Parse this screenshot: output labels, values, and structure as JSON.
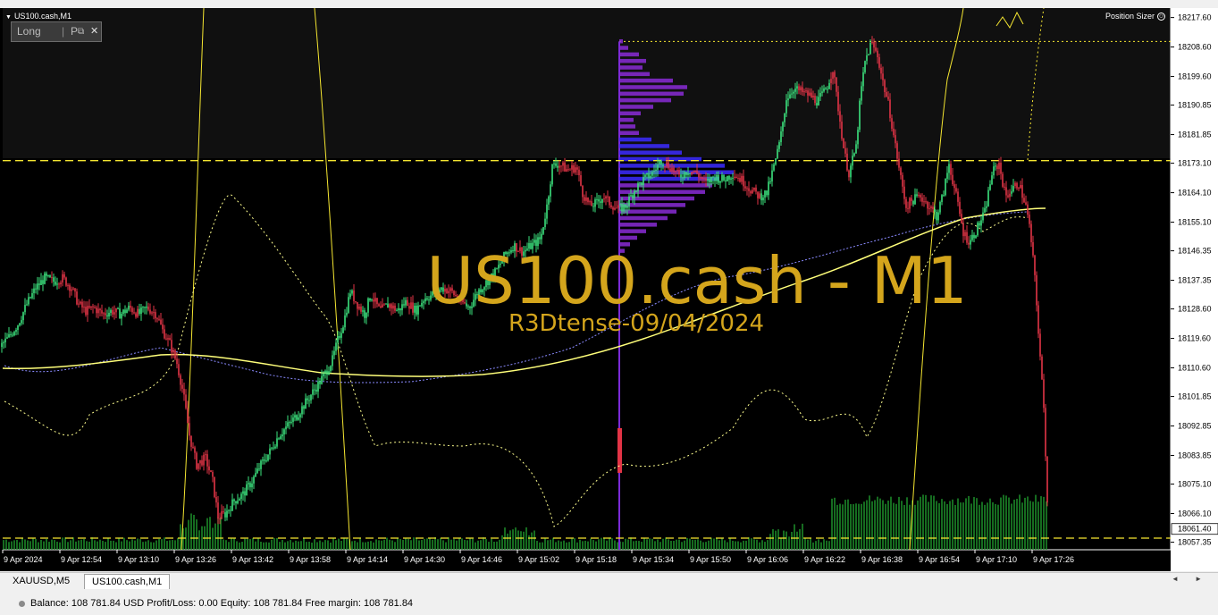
{
  "window": {
    "title": "US100.cash,M1",
    "panel_direction": "Long",
    "panel_tab": "P",
    "panel_restore_icon": "restore-window-icon",
    "panel_close": "✕",
    "position_sizer": "Position Sizer",
    "position_sizer_icon": "smiley-icon"
  },
  "watermark": {
    "title": "US100.cash - M1",
    "subtitle": "R3Dtense-09/04/2024",
    "color": "#d4a51c"
  },
  "chart_data": {
    "type": "candlestick",
    "symbol": "US100.cash",
    "timeframe": "M1",
    "ylim": [
      18054.5,
      18220.5
    ],
    "y_ticks": [
      "18217.60",
      "18208.60",
      "18199.60",
      "18190.85",
      "18181.85",
      "18173.10",
      "18164.10",
      "18155.10",
      "18146.35",
      "18137.35",
      "18128.60",
      "18119.60",
      "18110.60",
      "18101.85",
      "18092.85",
      "18083.85",
      "18075.10",
      "18066.10",
      "18057.35"
    ],
    "current_price": "18061.40",
    "x_ticks": [
      "9 Apr 2024",
      "9 Apr 12:54",
      "9 Apr 13:10",
      "9 Apr 13:26",
      "9 Apr 13:42",
      "9 Apr 13:58",
      "9 Apr 14:14",
      "9 Apr 14:30",
      "9 Apr 14:46",
      "9 Apr 15:02",
      "9 Apr 15:18",
      "9 Apr 15:34",
      "9 Apr 15:50",
      "9 Apr 16:06",
      "9 Apr 16:22",
      "9 Apr 16:38",
      "9 Apr 16:54",
      "9 Apr 17:10",
      "9 Apr 17:26"
    ],
    "series": [
      {
        "name": "price",
        "points": [
          [
            0,
            18117
          ],
          [
            10,
            18120
          ],
          [
            20,
            18124
          ],
          [
            30,
            18130
          ],
          [
            40,
            18135
          ],
          [
            50,
            18138
          ],
          [
            60,
            18137
          ],
          [
            70,
            18138
          ],
          [
            80,
            18135
          ],
          [
            88,
            18130
          ],
          [
            96,
            18128
          ],
          [
            105,
            18129
          ],
          [
            115,
            18127
          ],
          [
            125,
            18128
          ],
          [
            135,
            18127
          ],
          [
            145,
            18129
          ],
          [
            155,
            18127
          ],
          [
            165,
            18129
          ],
          [
            175,
            18127
          ],
          [
            182,
            18122
          ],
          [
            190,
            18118
          ],
          [
            198,
            18112
          ],
          [
            205,
            18103
          ],
          [
            212,
            18090
          ],
          [
            220,
            18081
          ],
          [
            230,
            18083
          ],
          [
            238,
            18076
          ],
          [
            244,
            18065
          ],
          [
            252,
            18066
          ],
          [
            262,
            18070
          ],
          [
            272,
            18072
          ],
          [
            282,
            18076
          ],
          [
            292,
            18081
          ],
          [
            302,
            18085
          ],
          [
            312,
            18090
          ],
          [
            322,
            18093
          ],
          [
            332,
            18096
          ],
          [
            342,
            18100
          ],
          [
            352,
            18104
          ],
          [
            362,
            18108
          ],
          [
            372,
            18113
          ],
          [
            378,
            18119
          ],
          [
            385,
            18125
          ],
          [
            392,
            18134
          ],
          [
            400,
            18130
          ],
          [
            408,
            18127
          ],
          [
            415,
            18133
          ],
          [
            425,
            18128
          ],
          [
            435,
            18130
          ],
          [
            445,
            18128
          ],
          [
            455,
            18131
          ],
          [
            465,
            18128
          ],
          [
            475,
            18132
          ],
          [
            485,
            18133
          ],
          [
            495,
            18135
          ],
          [
            505,
            18134
          ],
          [
            515,
            18131
          ],
          [
            525,
            18129
          ],
          [
            535,
            18134
          ],
          [
            545,
            18137
          ],
          [
            555,
            18140
          ],
          [
            565,
            18145
          ],
          [
            575,
            18148
          ],
          [
            585,
            18146
          ],
          [
            595,
            18148
          ],
          [
            605,
            18150
          ],
          [
            612,
            18160
          ],
          [
            618,
            18172
          ],
          [
            625,
            18173
          ],
          [
            635,
            18171
          ],
          [
            645,
            18172
          ],
          [
            652,
            18164
          ],
          [
            660,
            18160
          ],
          [
            668,
            18161
          ],
          [
            675,
            18163
          ],
          [
            682,
            18161
          ],
          [
            692,
            18159
          ],
          [
            700,
            18160
          ],
          [
            710,
            18165
          ],
          [
            720,
            18168
          ],
          [
            730,
            18170
          ],
          [
            740,
            18174
          ],
          [
            750,
            18172
          ],
          [
            760,
            18169
          ],
          [
            770,
            18171
          ],
          [
            780,
            18170
          ],
          [
            790,
            18167
          ],
          [
            800,
            18169
          ],
          [
            810,
            18168
          ],
          [
            820,
            18170
          ],
          [
            830,
            18168
          ],
          [
            840,
            18165
          ],
          [
            850,
            18163
          ],
          [
            858,
            18164
          ],
          [
            866,
            18172
          ],
          [
            873,
            18180
          ],
          [
            880,
            18193
          ],
          [
            888,
            18196
          ],
          [
            896,
            18195
          ],
          [
            905,
            18194
          ],
          [
            915,
            18192
          ],
          [
            925,
            18196
          ],
          [
            932,
            18202
          ],
          [
            938,
            18190
          ],
          [
            945,
            18176
          ],
          [
            950,
            18170
          ],
          [
            958,
            18178
          ],
          [
            963,
            18194
          ],
          [
            968,
            18204
          ],
          [
            975,
            18210
          ],
          [
            982,
            18206
          ],
          [
            988,
            18198
          ],
          [
            995,
            18190
          ],
          [
            1001,
            18180
          ],
          [
            1007,
            18170
          ],
          [
            1014,
            18160
          ],
          [
            1022,
            18162
          ],
          [
            1030,
            18163
          ],
          [
            1040,
            18160
          ],
          [
            1048,
            18157
          ],
          [
            1055,
            18163
          ],
          [
            1062,
            18173
          ],
          [
            1070,
            18163
          ],
          [
            1078,
            18152
          ],
          [
            1085,
            18149
          ],
          [
            1093,
            18153
          ],
          [
            1102,
            18158
          ],
          [
            1110,
            18170
          ],
          [
            1118,
            18173
          ],
          [
            1125,
            18163
          ],
          [
            1132,
            18165
          ],
          [
            1140,
            18167
          ],
          [
            1148,
            18160
          ],
          [
            1153,
            18152
          ],
          [
            1158,
            18138
          ],
          [
            1163,
            18118
          ],
          [
            1168,
            18098
          ],
          [
            1173,
            18064
          ]
        ]
      }
    ],
    "horizontal_levels": [
      18173.9,
      18058.6
    ],
    "profile_top": 18210.3,
    "colors": {
      "bull": "#3ce37e",
      "bear": "#e23446",
      "volume": "#1f9a2e",
      "ma": "#ffff7a",
      "envelope": "#ffff8f",
      "level": "#f5e631",
      "profile_blue": "#3c2cff",
      "profile_violet": "#8a2bd6"
    }
  },
  "tabs": [
    "XAUUSD,M5",
    "US100.cash,M1"
  ],
  "active_tab": 1,
  "tab_arrows": "◄ ►",
  "status": {
    "text": "Balance: 108 781.84 USD  Profit/Loss: 0.00  Equity: 108 781.84  Free margin: 108 781.84"
  }
}
